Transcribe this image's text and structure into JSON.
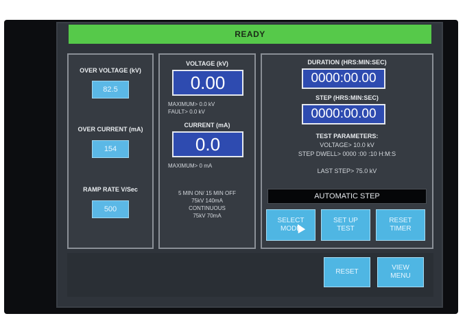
{
  "status": {
    "text": "READY",
    "color": "#56c94a"
  },
  "left_panel": {
    "over_voltage": {
      "label": "OVER VOLTAGE (kV)",
      "value": "82.5"
    },
    "over_current": {
      "label": "OVER CURRENT (mA)",
      "value": "154"
    },
    "ramp_rate": {
      "label": "RAMP RATE V/Sec",
      "value": "500"
    }
  },
  "mid_panel": {
    "voltage": {
      "label": "VOLTAGE (kV)",
      "value": "0.00",
      "maximum": "MAXIMUM> 0.0 kV",
      "fault": "FAULT> 0.0 kV"
    },
    "current": {
      "label": "CURRENT (mA)",
      "value": "0.0",
      "maximum": "MAXIMUM> 0 mA"
    },
    "notes": [
      "5 MIN ON/ 15 MIN OFF",
      "75kV 140mA",
      "CONTINUOUS",
      "75kV 70mA"
    ]
  },
  "right_panel": {
    "duration": {
      "label": "DURATION (HRS:MIN:SEC)",
      "value": "0000:00.00"
    },
    "step": {
      "label": "STEP (HRS:MIN:SEC)",
      "value": "0000:00.00"
    },
    "test_parameters": {
      "title": "TEST PARAMETERS:",
      "voltage": "VOLTAGE> 10.0 kV",
      "step_dwell": "STEP DWELL> 0000 :00 :10 H:M:S",
      "last_step": "LAST STEP> 75.0 kV"
    },
    "mode": "AUTOMATIC STEP",
    "buttons": {
      "select_mode": [
        "SELECT",
        "MODE"
      ],
      "set_up_test": [
        "SET UP",
        "TEST"
      ],
      "reset_timer": [
        "RESET",
        "TIMER"
      ]
    }
  },
  "bottom": {
    "reset": "RESET",
    "view_menu": [
      "VIEW",
      "MENU"
    ]
  },
  "icons": {
    "cursor": "pointer-cursor-icon"
  }
}
